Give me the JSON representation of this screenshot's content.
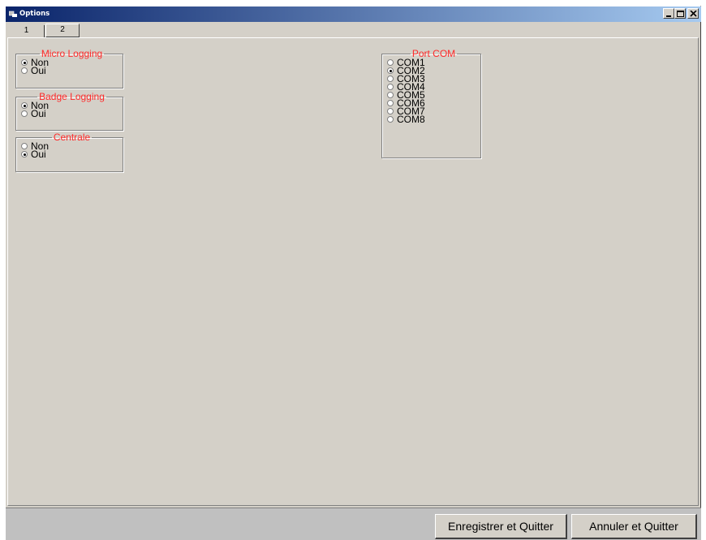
{
  "window": {
    "title": "Options",
    "icon": "app-icon"
  },
  "titlebar_buttons": [
    "minimize-icon",
    "maximize-icon",
    "close-icon"
  ],
  "tabs": [
    {
      "label": "1",
      "selected": false
    },
    {
      "label": "2",
      "selected": true
    }
  ],
  "groups": {
    "micro_logging": {
      "title": "Micro Logging",
      "options": [
        {
          "label": "Non",
          "checked": true
        },
        {
          "label": "Oui",
          "checked": false
        }
      ]
    },
    "badge_logging": {
      "title": "Badge Logging",
      "options": [
        {
          "label": "Non",
          "checked": true
        },
        {
          "label": "Oui",
          "checked": false
        }
      ]
    },
    "centrale": {
      "title": "Centrale",
      "options": [
        {
          "label": "Non",
          "checked": false
        },
        {
          "label": "Oui",
          "checked": true
        }
      ]
    },
    "port_com": {
      "title": "Port COM",
      "options": [
        {
          "label": "COM1",
          "checked": false
        },
        {
          "label": "COM2",
          "checked": true
        },
        {
          "label": "COM3",
          "checked": false
        },
        {
          "label": "COM4",
          "checked": false
        },
        {
          "label": "COM5",
          "checked": false
        },
        {
          "label": "COM6",
          "checked": false
        },
        {
          "label": "COM7",
          "checked": false
        },
        {
          "label": "COM8",
          "checked": false
        }
      ]
    }
  },
  "buttons": {
    "save": "Enregistrer et Quitter",
    "cancel": "Annuler et Quitter"
  },
  "colors": {
    "titlebar_start": "#0a246a",
    "titlebar_end": "#a6caf0",
    "group_title": "#ff2a2a",
    "face": "#d4d0c8"
  }
}
